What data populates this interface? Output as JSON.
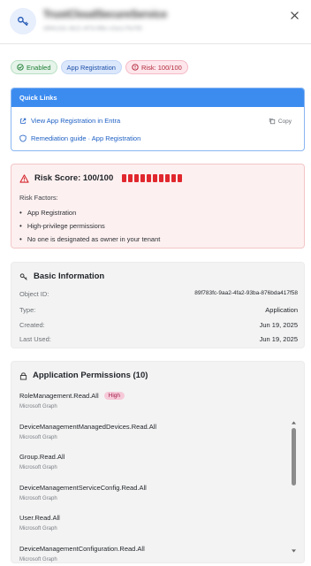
{
  "header": {
    "title_prefix": "TrustCloudSecureService",
    "title_suffix": "",
    "subtitle": "d9f4c2d1-3b21-4f7d-9f8c-c0a1c7fa795",
    "close_label": "×"
  },
  "badges": [
    {
      "label": "Enabled",
      "icon": "check-circle-icon"
    },
    {
      "label": "App Registration",
      "icon": ""
    },
    {
      "label": "Risk: 100/100",
      "icon": "shield-alert-icon"
    }
  ],
  "quick_links": {
    "title": "Quick Links",
    "items": [
      {
        "label": "View App Registration in Entra",
        "icon": "external-link-icon"
      },
      {
        "label": "Remediation guide · App Registration",
        "icon": "shield-icon"
      }
    ],
    "copy_label": "Copy"
  },
  "risk": {
    "title": "Risk Score: 100/100",
    "score": 100,
    "bars": 10,
    "factors_label": "Risk Factors:",
    "factors": [
      "App Registration",
      "High-privilege permissions",
      "No one is designated as owner in your tenant"
    ],
    "color": "#e0282e"
  },
  "basic_info": {
    "title": "Basic Information",
    "rows": [
      {
        "key": "Object ID:",
        "value": "89f783fc-9aa2-4fa2-93ba-876bda417f58"
      },
      {
        "key": "Type:",
        "value": "Application"
      },
      {
        "key": "Created:",
        "value": "Jun 19, 2025"
      },
      {
        "key": "Last Used:",
        "value": "Jun 19, 2025"
      }
    ]
  },
  "permissions": {
    "title": "Application Permissions (10)",
    "items": [
      {
        "name": "RoleManagement.Read.All",
        "source": "Microsoft Graph",
        "badge": "High"
      },
      {
        "name": "DeviceManagementManagedDevices.Read.All",
        "source": "Microsoft Graph",
        "badge": ""
      },
      {
        "name": "Group.Read.All",
        "source": "Microsoft Graph",
        "badge": ""
      },
      {
        "name": "DeviceManagementServiceConfig.Read.All",
        "source": "Microsoft Graph",
        "badge": ""
      },
      {
        "name": "User.Read.All",
        "source": "Microsoft Graph",
        "badge": ""
      },
      {
        "name": "DeviceManagementConfiguration.Read.All",
        "source": "Microsoft Graph",
        "badge": ""
      }
    ]
  },
  "colors": {
    "accent": "#3c8cf0",
    "danger": "#e0282e",
    "success": "#1e7e34"
  }
}
